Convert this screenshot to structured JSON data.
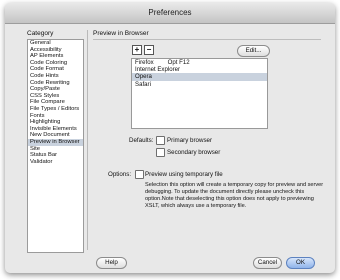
{
  "window": {
    "title": "Preferences"
  },
  "category": {
    "header": "Category",
    "items": [
      "General",
      "Accessibility",
      "AP Elements",
      "Code Coloring",
      "Code Format",
      "Code Hints",
      "Code Rewriting",
      "Copy/Paste",
      "CSS Styles",
      "File Compare",
      "File Types / Editors",
      "Fonts",
      "Highlighting",
      "Invisible Elements",
      "New Document",
      "Preview in Browser",
      "Site",
      "Status Bar",
      "Validator"
    ],
    "selected_index": 15
  },
  "panel": {
    "title": "Preview in Browser",
    "add_symbol": "+",
    "remove_symbol": "−",
    "edit_label": "Edit...",
    "browsers": [
      {
        "name": "Firefox",
        "key": "Opt F12"
      },
      {
        "name": "Internet Explorer",
        "key": ""
      },
      {
        "name": "Opera",
        "key": ""
      },
      {
        "name": "Safari",
        "key": ""
      }
    ],
    "selected_browser_index": 2,
    "defaults_label": "Defaults:",
    "primary_browser_label": "Primary browser",
    "secondary_browser_label": "Secondary browser",
    "options_label": "Options:",
    "temp_file_label": "Preview using temporary file",
    "description": "Selection this option will create a temporary copy for preview and server debugging. To update the document directly please uncheck this option.Note that deselecting this option does not apply to previewing XSLT, which always use a temporary file."
  },
  "footer": {
    "help_label": "Help",
    "cancel_label": "Cancel",
    "ok_label": "OK"
  }
}
